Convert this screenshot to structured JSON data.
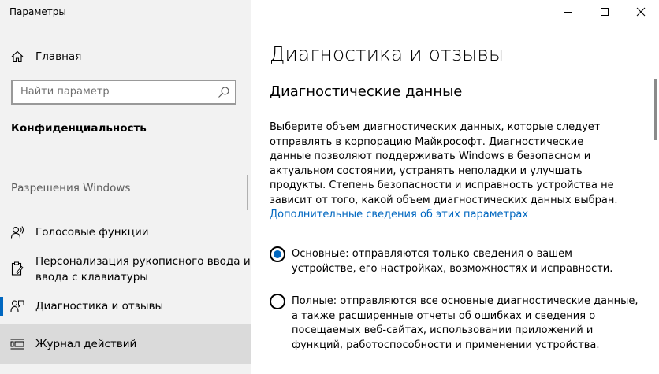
{
  "window": {
    "title": "Параметры"
  },
  "sidebar": {
    "home_label": "Главная",
    "search_placeholder": "Найти параметр",
    "section_title": "Конфиденциальность",
    "group_label": "Разрешения Windows",
    "items": [
      {
        "label": "Голосовые функции",
        "icon": "speech-icon"
      },
      {
        "label_line1": "Персонализация рукописного ввода и",
        "label_line2": "ввода с клавиатуры",
        "icon": "clipboard-pen-icon"
      },
      {
        "label": "Диагностика и отзывы",
        "icon": "feedback-icon",
        "active": true
      },
      {
        "label": "Журнал действий",
        "icon": "timeline-icon",
        "hover": true
      }
    ]
  },
  "main": {
    "title": "Диагностика и отзывы",
    "subtitle": "Диагностические данные",
    "description": "Выберите объем диагностических данных, которые следует отправлять в корпорацию Майкрософт. Диагностические данные позволяют поддерживать Windows в безопасном и актуальном состоянии, устранять неполадки и улучшать продукты. Степень безопасности и исправность устройства не зависит от того, какой объем диагностических данных выбран.",
    "link": "Дополнительные сведения об этих параметрах",
    "options": [
      {
        "label": "Основные: отправляются только сведения о вашем устройстве, его настройках, возможностях и исправности.",
        "selected": true
      },
      {
        "label": "Полные: отправляются все основные диагностические данные, а также расширенные отчеты об ошибках и сведения о посещаемых веб-сайтах, использовании приложений и функций, работоспособности и применении устройства.",
        "selected": false
      }
    ]
  },
  "colors": {
    "accent": "#0067c0",
    "sidebar_bg": "#f2f2f2",
    "hover_bg": "#dadada"
  }
}
